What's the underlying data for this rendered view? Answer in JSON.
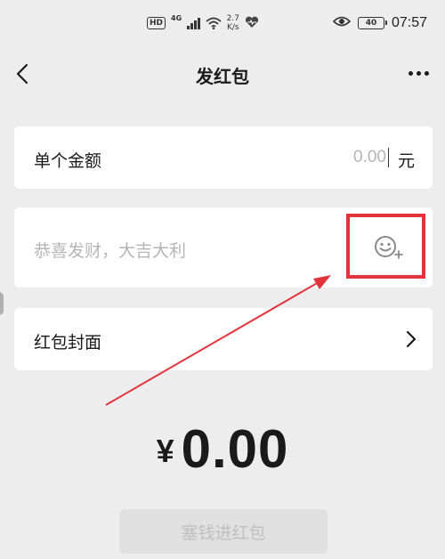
{
  "status_bar": {
    "hd": "HD",
    "network": "4G",
    "speed_value": "2.7",
    "speed_unit": "K/s",
    "battery": "40",
    "time": "07:57"
  },
  "nav": {
    "title": "发红包"
  },
  "amount": {
    "label": "单个金额",
    "value": "0.00",
    "unit": "元"
  },
  "greeting": {
    "placeholder": "恭喜发财，大吉大利"
  },
  "cover": {
    "label": "红包封面"
  },
  "total": {
    "currency": "¥",
    "value": "0.00"
  },
  "submit": {
    "label": "塞钱进红包"
  },
  "colors": {
    "background": "#ededed",
    "card": "#ffffff",
    "annotation": "#e3343c",
    "placeholder": "#b5b5b5",
    "disabled_button": "#e0e0e0"
  }
}
